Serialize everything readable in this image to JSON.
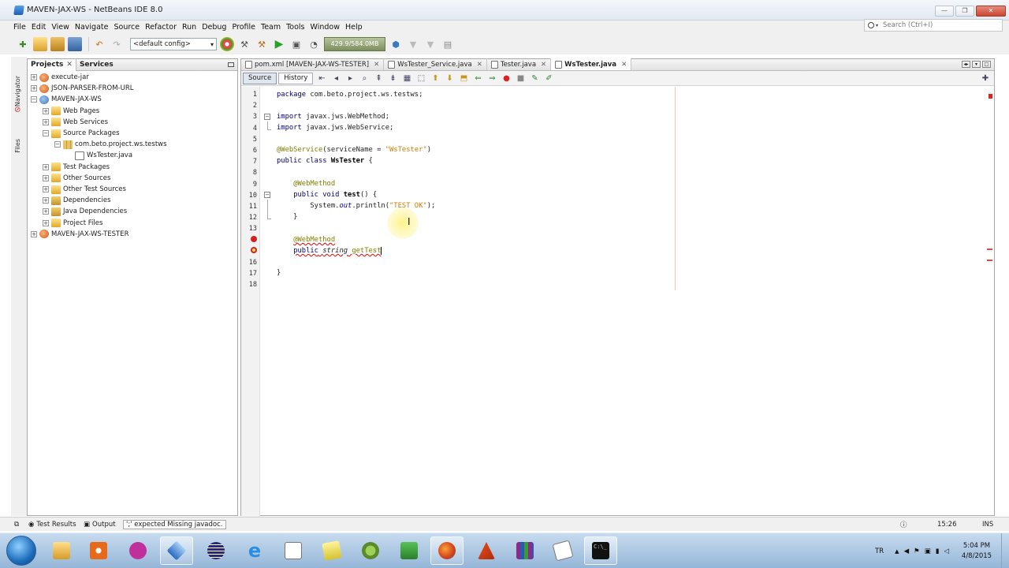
{
  "window": {
    "title": "MAVEN-JAX-WS - NetBeans IDE 8.0"
  },
  "menu": [
    "File",
    "Edit",
    "View",
    "Navigate",
    "Source",
    "Refactor",
    "Run",
    "Debug",
    "Profile",
    "Team",
    "Tools",
    "Window",
    "Help"
  ],
  "search": {
    "placeholder": "Search (Ctrl+I)"
  },
  "toolbar": {
    "config": "<default config>",
    "memory": "429.9/584.0MB"
  },
  "side_tabs": {
    "navigator": "Navigator",
    "files": "Files"
  },
  "projects_panel": {
    "tabs": [
      "Projects",
      "Services"
    ],
    "tree": [
      {
        "label": "execute-jar",
        "exp": "+",
        "icon": "proj"
      },
      {
        "label": "JSON-PARSER-FROM-URL",
        "exp": "+",
        "icon": "proj"
      },
      {
        "label": "MAVEN-JAX-WS",
        "exp": "−",
        "icon": "proj2"
      },
      {
        "label": "Web Pages",
        "exp": "+",
        "icon": "folder"
      },
      {
        "label": "Web Services",
        "exp": "+",
        "icon": "folder"
      },
      {
        "label": "Source Packages",
        "exp": "−",
        "icon": "folder"
      },
      {
        "label": "com.beto.project.ws.testws",
        "exp": "−",
        "icon": "pkg"
      },
      {
        "label": "WsTester.java",
        "exp": "",
        "icon": "java"
      },
      {
        "label": "Test Packages",
        "exp": "+",
        "icon": "folder"
      },
      {
        "label": "Other Sources",
        "exp": "+",
        "icon": "folder"
      },
      {
        "label": "Other Test Sources",
        "exp": "+",
        "icon": "folder"
      },
      {
        "label": "Dependencies",
        "exp": "+",
        "icon": "dep"
      },
      {
        "label": "Java Dependencies",
        "exp": "+",
        "icon": "dep"
      },
      {
        "label": "Project Files",
        "exp": "+",
        "icon": "folder"
      },
      {
        "label": "MAVEN-JAX-WS-TESTER",
        "exp": "+",
        "icon": "proj"
      }
    ]
  },
  "editor": {
    "tabs": [
      "pom.xml [MAVEN-JAX-WS-TESTER]",
      "WsTester_Service.java",
      "Tester.java",
      "WsTester.java"
    ],
    "active_tab": "WsTester.java",
    "modes": [
      "Source",
      "History"
    ],
    "line_numbers": [
      "1",
      "2",
      "3",
      "4",
      "5",
      "6",
      "7",
      "8",
      "9",
      "10",
      "11",
      "12",
      "13",
      "",
      "",
      "16",
      "17",
      "18"
    ]
  },
  "statusbar": {
    "test_results": "Test Results",
    "output": "Output",
    "message": "';' expected  Missing javadoc.",
    "position": "15:26",
    "mode": "INS"
  },
  "taskbar": {
    "lang": "TR",
    "time": "5:04 PM",
    "date": "4/8/2015"
  }
}
